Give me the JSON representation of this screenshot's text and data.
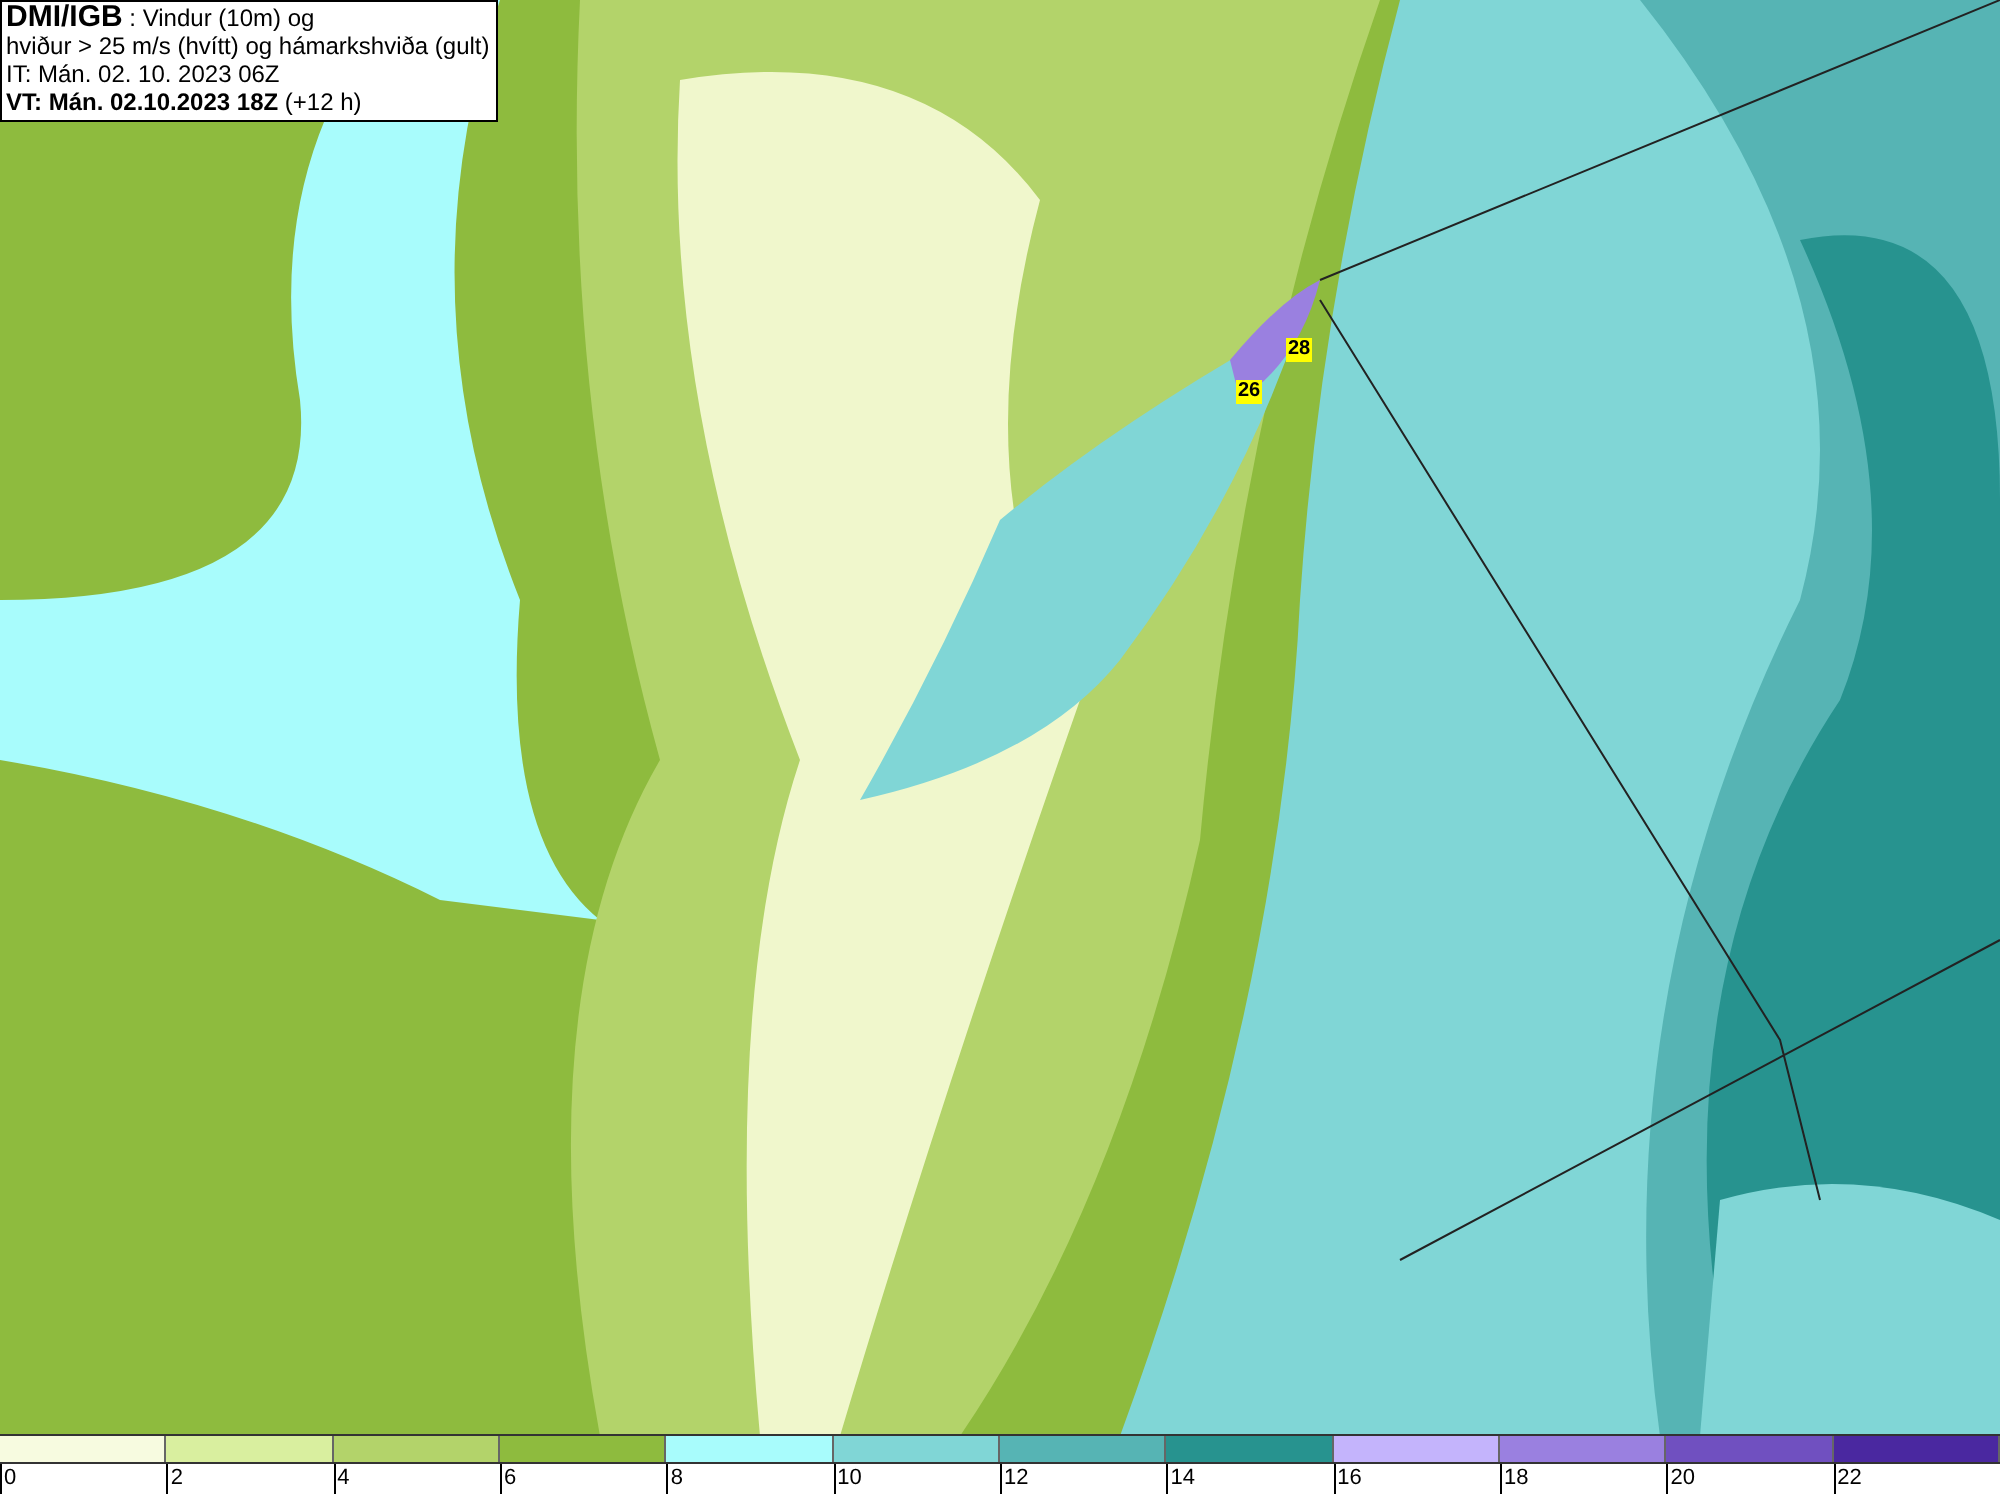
{
  "title_box": {
    "lines": [
      "**DMI/IGB** : Vindur (10m) og",
      "hviður > 25 m/s (hvítt) og hámarkshviða (gult)",
      "IT: Mán. 02. 10. 2023 06Z",
      "**VT: Mán. 02.10.2023 18Z** (+12 h)"
    ]
  },
  "map": {
    "gust_labels": [
      "28",
      "26"
    ]
  },
  "legend": [
    {
      "color": "#f7fbe0",
      "label": "0"
    },
    {
      "color": "#d9ef9f",
      "label": "2"
    },
    {
      "color": "#b3d36a",
      "label": "4"
    },
    {
      "color": "#8ebb3e",
      "label": "6"
    },
    {
      "color": "#a8fcfc",
      "label": "8"
    },
    {
      "color": "#80d6d6",
      "label": "10"
    },
    {
      "color": "#56b4b4",
      "label": "12"
    },
    {
      "color": "#27938f",
      "label": "14"
    },
    {
      "color": "#c4b4fc",
      "label": "16"
    },
    {
      "color": "#9a80e0",
      "label": "18"
    },
    {
      "color": "#7050c0",
      "label": "20"
    },
    {
      "color": "#4a28a0",
      "label": "22"
    }
  ]
}
